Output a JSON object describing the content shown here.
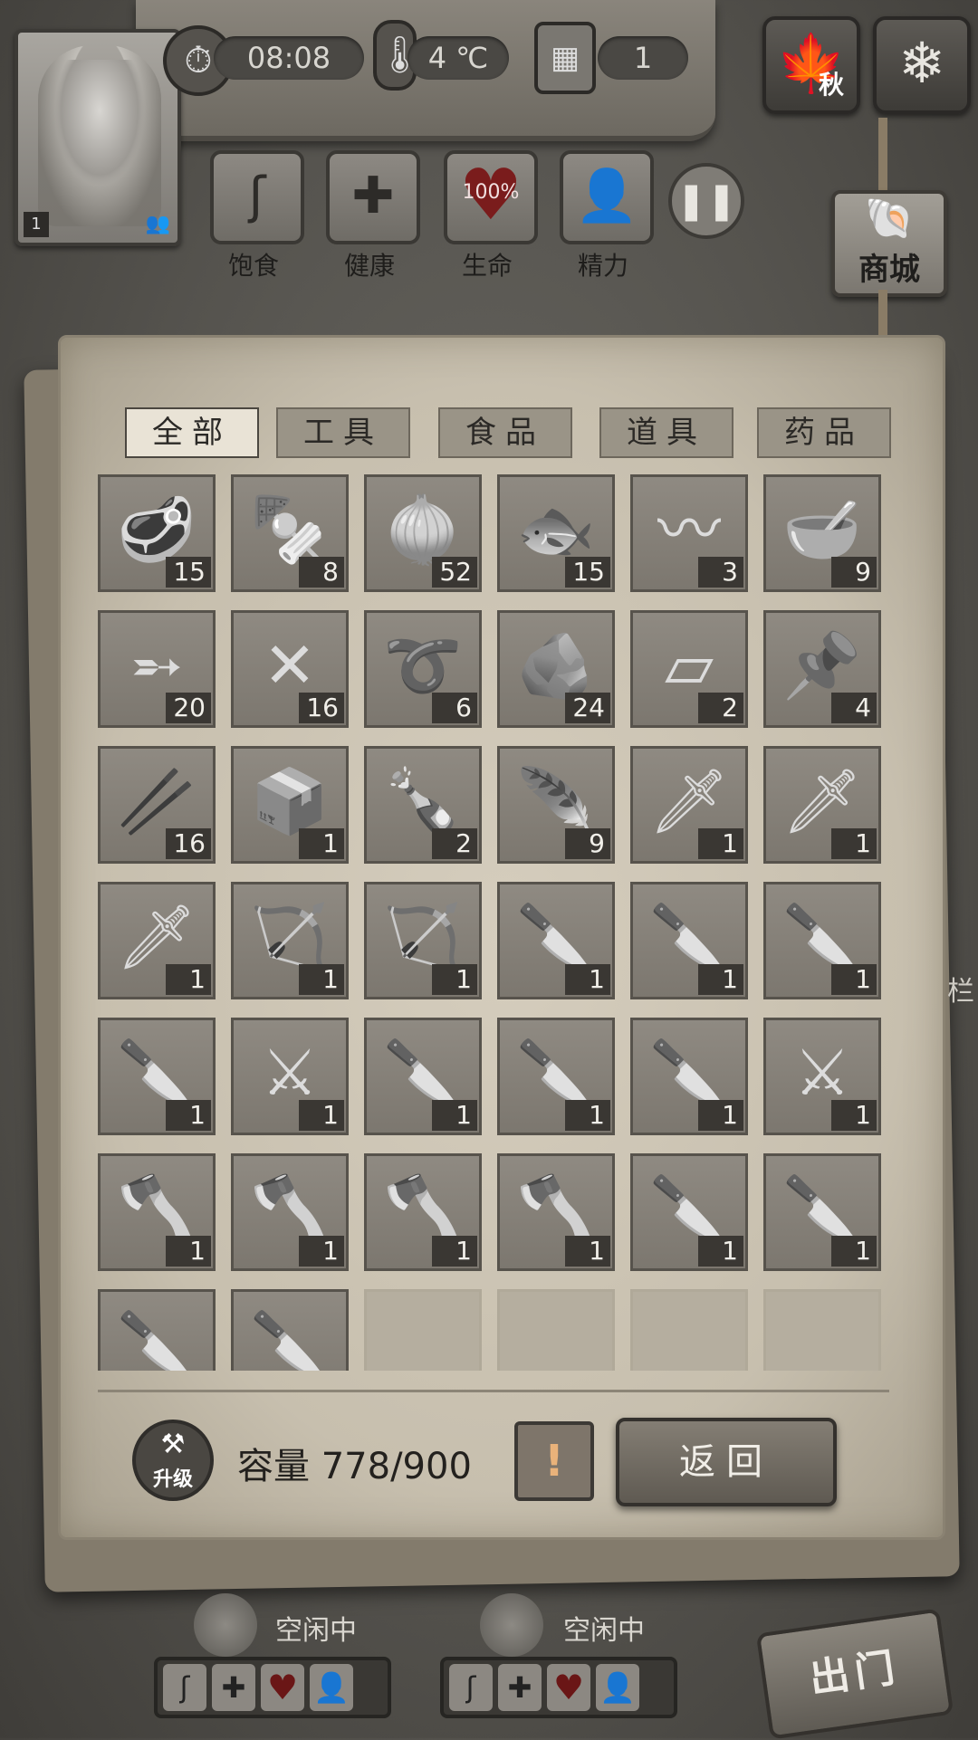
{
  "header": {
    "level": "1",
    "time": "08:08",
    "temperature": "4 ℃",
    "day": "1",
    "season": "秋",
    "stats": [
      {
        "label": "饱食",
        "icon": "stomach-icon"
      },
      {
        "label": "健康",
        "icon": "cross-icon"
      },
      {
        "label": "生命",
        "icon": "heart-icon",
        "value": "100%"
      },
      {
        "label": "精力",
        "icon": "person-icon"
      }
    ],
    "shop_label": "商城"
  },
  "tabs": [
    {
      "label": "全部",
      "active": true
    },
    {
      "label": "工具",
      "active": false
    },
    {
      "label": "食品",
      "active": false
    },
    {
      "label": "道具",
      "active": false
    },
    {
      "label": "药品",
      "active": false
    }
  ],
  "items": [
    {
      "name": "cooked-meat",
      "icon": "🥩",
      "qty": "15"
    },
    {
      "name": "meat-skewer",
      "icon": "🍢",
      "qty": "8"
    },
    {
      "name": "onions",
      "icon": "🧅",
      "qty": "52"
    },
    {
      "name": "dried-fish",
      "icon": "🐟",
      "qty": "15"
    },
    {
      "name": "cloth-strip",
      "icon": "〰",
      "qty": "3"
    },
    {
      "name": "bowl-of-water",
      "icon": "🥣",
      "qty": "9"
    },
    {
      "name": "arrows",
      "icon": "➵",
      "qty": "20"
    },
    {
      "name": "crossed-arrows",
      "icon": "✕",
      "qty": "16"
    },
    {
      "name": "rope",
      "icon": "➰",
      "qty": "6"
    },
    {
      "name": "stone",
      "icon": "🪨",
      "qty": "24"
    },
    {
      "name": "wood-plank",
      "icon": "▱",
      "qty": "2"
    },
    {
      "name": "iron-nail",
      "icon": "📌",
      "qty": "4"
    },
    {
      "name": "wooden-sticks",
      "icon": "🥢",
      "qty": "16"
    },
    {
      "name": "scrap-box",
      "icon": "📦",
      "qty": "1"
    },
    {
      "name": "bottle",
      "icon": "🍾",
      "qty": "2"
    },
    {
      "name": "feathers",
      "icon": "🪶",
      "qty": "9"
    },
    {
      "name": "spear",
      "icon": "🗡",
      "qty": "1"
    },
    {
      "name": "spear",
      "icon": "🗡",
      "qty": "1"
    },
    {
      "name": "spear",
      "icon": "🗡",
      "qty": "1"
    },
    {
      "name": "bow",
      "icon": "🏹",
      "qty": "1"
    },
    {
      "name": "bow",
      "icon": "🏹",
      "qty": "1"
    },
    {
      "name": "stone-blade",
      "icon": "🔪",
      "qty": "1"
    },
    {
      "name": "stone-blade",
      "icon": "🔪",
      "qty": "1"
    },
    {
      "name": "stone-blade",
      "icon": "🔪",
      "qty": "1"
    },
    {
      "name": "stone-blade",
      "icon": "🔪",
      "qty": "1"
    },
    {
      "name": "machete",
      "icon": "⚔",
      "qty": "1"
    },
    {
      "name": "stone-blade",
      "icon": "🔪",
      "qty": "1"
    },
    {
      "name": "stone-blade",
      "icon": "🔪",
      "qty": "1"
    },
    {
      "name": "stone-blade",
      "icon": "🔪",
      "qty": "1"
    },
    {
      "name": "machete",
      "icon": "⚔",
      "qty": "1"
    },
    {
      "name": "stone-axe",
      "icon": "🪓",
      "qty": "1"
    },
    {
      "name": "stone-axe",
      "icon": "🪓",
      "qty": "1"
    },
    {
      "name": "stone-axe",
      "icon": "🪓",
      "qty": "1"
    },
    {
      "name": "stone-axe",
      "icon": "🪓",
      "qty": "1"
    },
    {
      "name": "stone-blade",
      "icon": "🔪",
      "qty": "1"
    },
    {
      "name": "stone-blade",
      "icon": "🔪",
      "qty": "1"
    },
    {
      "name": "stone-blade",
      "icon": "🔪",
      "qty": ""
    },
    {
      "name": "stone-blade",
      "icon": "🔪",
      "qty": ""
    },
    {
      "name": "empty",
      "icon": "",
      "qty": ""
    },
    {
      "name": "empty",
      "icon": "",
      "qty": ""
    },
    {
      "name": "empty",
      "icon": "",
      "qty": ""
    },
    {
      "name": "empty",
      "icon": "",
      "qty": ""
    }
  ],
  "footer": {
    "upgrade_label": "升级",
    "capacity_label": "容量",
    "capacity_value": "778/900",
    "warning": "!",
    "return_label": "返回"
  },
  "characters": [
    {
      "status": "空闲中"
    },
    {
      "status": "空闲中"
    }
  ],
  "exit_label": "出门",
  "side_label": "栏"
}
